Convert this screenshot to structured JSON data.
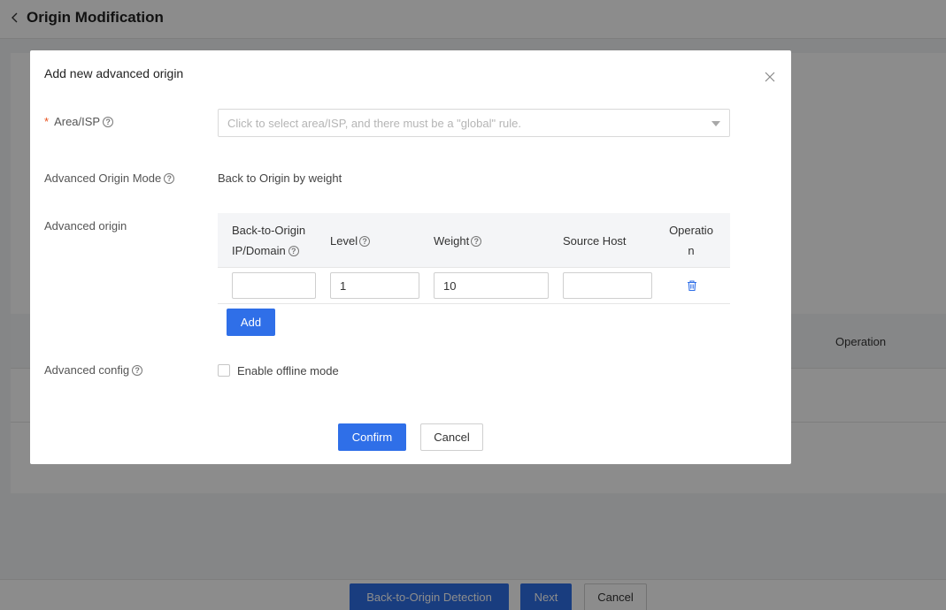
{
  "page": {
    "title": "Origin Modification",
    "table_operation_header": "Operation",
    "footer": {
      "detection_label": "Back-to-Origin Detection",
      "next_label": "Next",
      "cancel_label": "Cancel"
    }
  },
  "modal": {
    "title": "Add new advanced origin",
    "area_isp": {
      "label": "Area/ISP",
      "required_mark": "*",
      "placeholder": "Click to select area/ISP, and there must be a \"global\" rule."
    },
    "advanced_origin_mode": {
      "label": "Advanced Origin Mode",
      "value": "Back to Origin by weight"
    },
    "advanced_origin": {
      "label": "Advanced origin",
      "columns": {
        "ip_domain_line1": "Back-to-Origin",
        "ip_domain_line2": "IP/Domain",
        "level": "Level",
        "weight": "Weight",
        "source_host": "Source Host",
        "operation_line1": "Operatio",
        "operation_line2": "n"
      },
      "rows": [
        {
          "ip_domain": "",
          "level": "1",
          "weight": "10",
          "source_host": ""
        }
      ],
      "add_label": "Add"
    },
    "advanced_config": {
      "label": "Advanced config",
      "offline_mode_label": "Enable offline mode",
      "offline_mode_checked": false
    },
    "confirm_label": "Confirm",
    "cancel_label": "Cancel"
  },
  "colors": {
    "primary": "#2f6fe8",
    "required": "#e8501c"
  },
  "icons": {
    "back": "chevron-left-icon",
    "close": "close-icon",
    "help": "question-circle-icon",
    "caret": "caret-down-icon",
    "delete": "trash-icon"
  }
}
